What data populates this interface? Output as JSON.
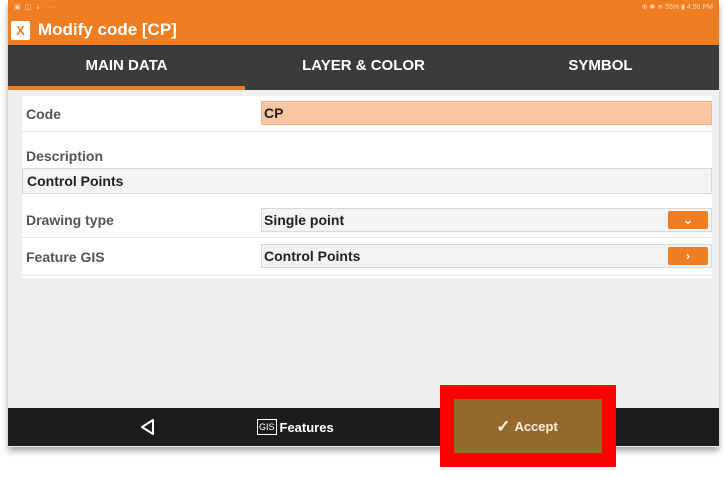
{
  "colors": {
    "accent": "#ef7d22",
    "tab_bg": "#3b3b3b",
    "nav_bg": "#1d1d1d",
    "code_bg": "#f9c6a1",
    "accept_bg": "#7a4d12",
    "highlight": "#ff0000"
  },
  "statusbar": {
    "left": "▣ ◫ ⇣ ···",
    "right": "⊕ ✱ ≋ 55% ▮ 4:58 PM"
  },
  "app": {
    "logo": "X",
    "title": "Modify code [CP]"
  },
  "tabs": [
    {
      "label": "MAIN DATA",
      "active": true
    },
    {
      "label": "LAYER & COLOR",
      "active": false
    },
    {
      "label": "SYMBOL",
      "active": false
    }
  ],
  "form": {
    "code_label": "Code",
    "code_value": "CP",
    "description_label": "Description",
    "description_value": "Control Points",
    "drawing_label": "Drawing type",
    "drawing_value": "Single point",
    "gis_label": "Feature GIS",
    "gis_value": "Control Points"
  },
  "icons": {
    "dropdown": "chevron-down-icon",
    "arrow": "chevron-right-icon",
    "back": "back-triangle-icon",
    "check": "check-icon",
    "gis": "gis-icon"
  },
  "glyphs": {
    "chevron_down": "⌄",
    "chevron_right": "›",
    "check": "✓",
    "gis": "GIS"
  },
  "navbar": {
    "features_label": "Features",
    "accept_label": "Accept"
  }
}
